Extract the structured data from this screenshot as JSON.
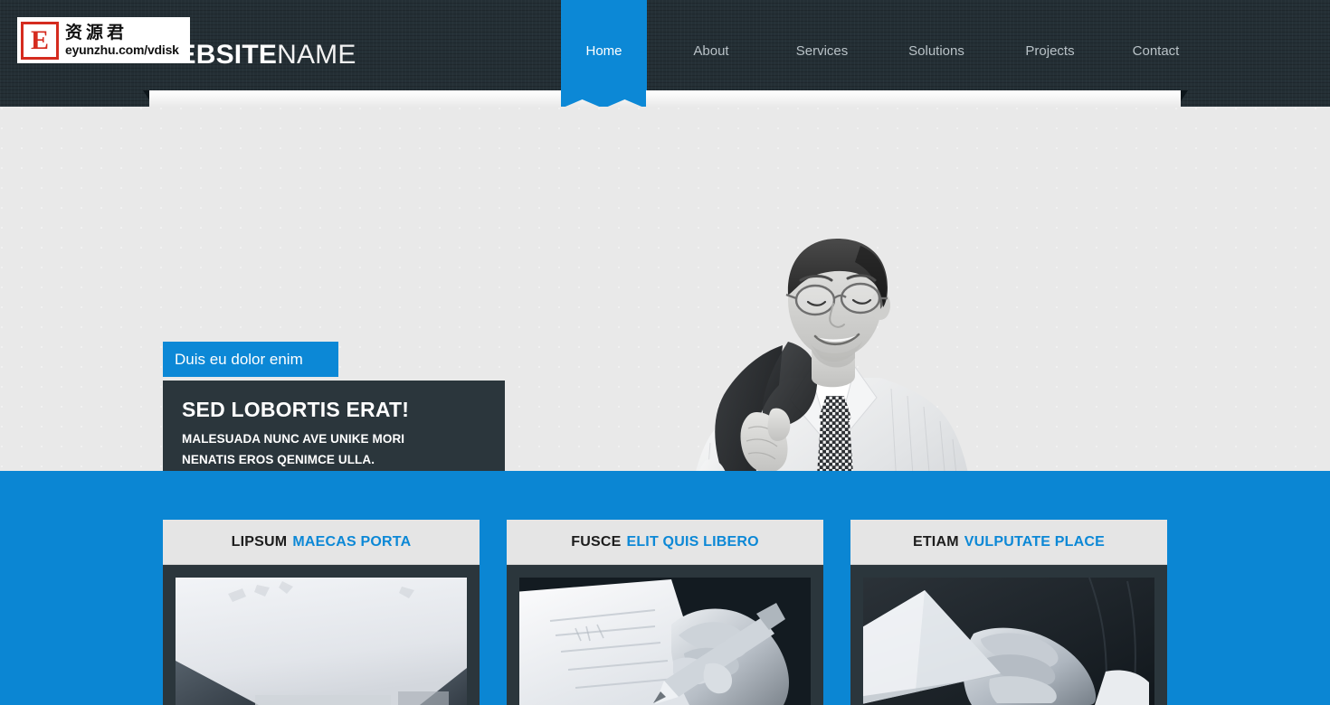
{
  "header": {
    "site_title_bold": "WEBSITE",
    "site_title_light": "NAME",
    "nav": [
      {
        "label": "Home",
        "active": true
      },
      {
        "label": "About",
        "active": false
      },
      {
        "label": "Services",
        "active": false
      },
      {
        "label": "Solutions",
        "active": false
      },
      {
        "label": "Projects",
        "active": false
      },
      {
        "label": "Contact",
        "active": false
      }
    ],
    "background_color": "#242f35",
    "accent_color": "#0c88d6"
  },
  "watermark": {
    "mark_letter": "E",
    "chinese_text": "资源君",
    "url_text": "eyunzhu.com/vdisk",
    "mark_color": "#d52b1e"
  },
  "hero": {
    "badge_label": "Duis eu dolor enim",
    "title": "SED LOBORTIS ERAT!",
    "subtitle_line1": "MALESUADA NUNC AVE UNIKE MORI",
    "subtitle_line2": "NENATIS EROS QENIMCE ULLA.",
    "image_alt": "businessman-with-jacket-over-shoulder",
    "background_color": "#e9e9e9",
    "box_color": "#2b363c"
  },
  "features": {
    "background_color": "#0b86d3",
    "cards": [
      {
        "title_dark": "LIPSUM",
        "title_accent": "MAECAS PORTA",
        "image_alt": "blank-paper-on-desk"
      },
      {
        "title_dark": "FUSCE",
        "title_accent": "ELIT QUIS LIBERO",
        "image_alt": "hand-writing-with-pen"
      },
      {
        "title_dark": "ETIAM",
        "title_accent": "VULPUTATE PLACE",
        "image_alt": "hand-holding-envelope"
      }
    ]
  }
}
